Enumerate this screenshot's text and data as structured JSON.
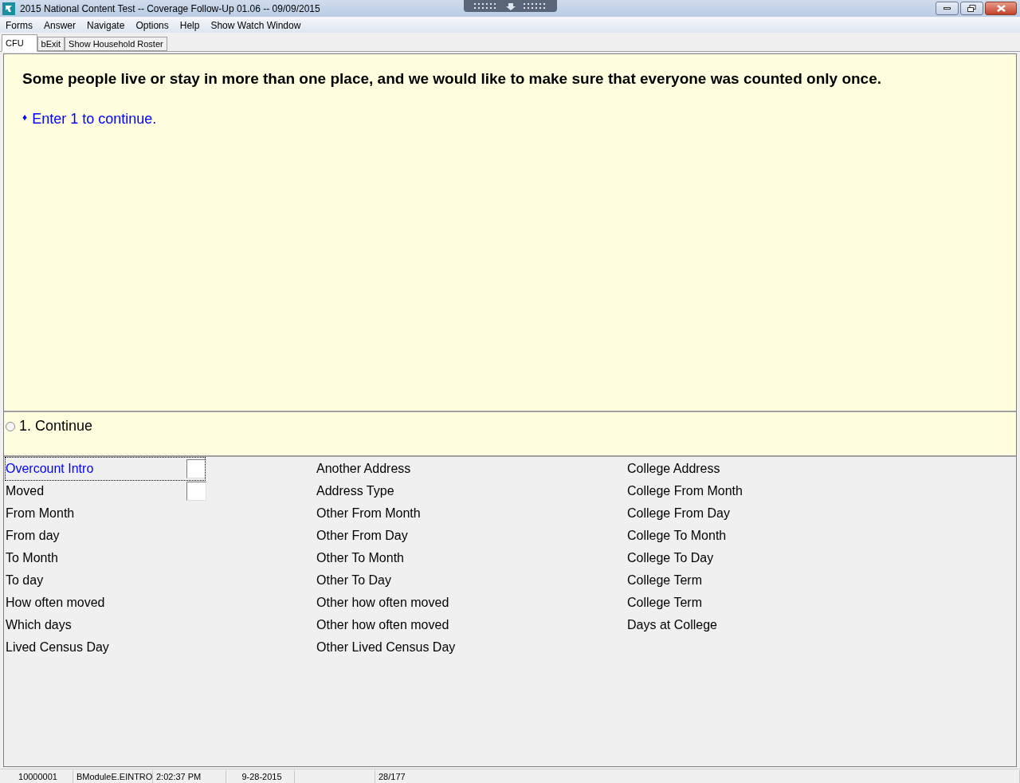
{
  "window": {
    "title": "2015 National Content Test -- Coverage Follow-Up 01.06 -- 09/09/2015"
  },
  "menu": [
    "Forms",
    "Answer",
    "Navigate",
    "Options",
    "Help",
    "Show Watch Window"
  ],
  "tabs": [
    {
      "label": "CFU",
      "selected": true
    },
    {
      "label": "bExit",
      "selected": false
    },
    {
      "label": "Show Household Roster",
      "selected": false
    }
  ],
  "question": {
    "text": "Some people live or stay in more than one place, and we would like to make sure that everyone was counted only once.",
    "instruction_bullet": "♦",
    "instruction": "Enter 1 to continue."
  },
  "answers": [
    {
      "label": "1. Continue",
      "selected": false
    }
  ],
  "field_columns": [
    [
      {
        "label": "Overcount Intro",
        "kind": "input",
        "current": true
      },
      {
        "label": "Moved",
        "kind": "input",
        "current": false
      },
      {
        "label": "From Month",
        "kind": "label",
        "current": false
      },
      {
        "label": "From day",
        "kind": "label",
        "current": false
      },
      {
        "label": "To Month",
        "kind": "label",
        "current": false
      },
      {
        "label": "To day",
        "kind": "label",
        "current": false
      },
      {
        "label": "How often moved",
        "kind": "label",
        "current": false
      },
      {
        "label": "Which days",
        "kind": "label",
        "current": false
      },
      {
        "label": "Lived Census Day",
        "kind": "label",
        "current": false
      }
    ],
    [
      {
        "label": "Another Address",
        "kind": "label",
        "current": false
      },
      {
        "label": "Address Type",
        "kind": "label",
        "current": false
      },
      {
        "label": "Other From Month",
        "kind": "label",
        "current": false
      },
      {
        "label": "Other From Day",
        "kind": "label",
        "current": false
      },
      {
        "label": "Other To Month",
        "kind": "label",
        "current": false
      },
      {
        "label": "Other To Day",
        "kind": "label",
        "current": false
      },
      {
        "label": "Other how often moved",
        "kind": "label",
        "current": false
      },
      {
        "label": "Other how often moved",
        "kind": "label",
        "current": false
      },
      {
        "label": "Other Lived Census Day",
        "kind": "label",
        "current": false
      }
    ],
    [
      {
        "label": "College Address",
        "kind": "label",
        "current": false
      },
      {
        "label": "College From Month",
        "kind": "label",
        "current": false
      },
      {
        "label": "College From Day",
        "kind": "label",
        "current": false
      },
      {
        "label": "College To Month",
        "kind": "label",
        "current": false
      },
      {
        "label": "College To Day",
        "kind": "label",
        "current": false
      },
      {
        "label": "College Term",
        "kind": "label",
        "current": false
      },
      {
        "label": "College Term",
        "kind": "label",
        "current": false
      },
      {
        "label": "Days at College",
        "kind": "label",
        "current": false
      }
    ]
  ],
  "status_bar": [
    "10000001",
    "BModuleE.EINTRO",
    "2:02:37 PM",
    "9-28-2015",
    "28/177"
  ]
}
